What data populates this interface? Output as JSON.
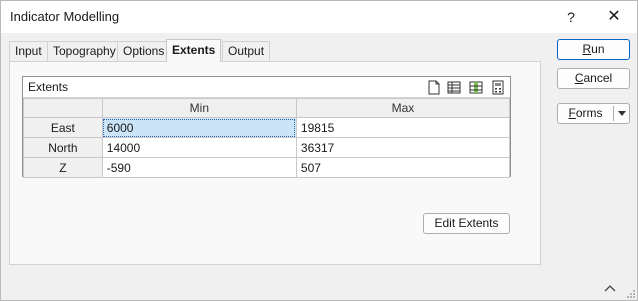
{
  "window": {
    "title": "Indicator Modelling",
    "help_label": "?",
    "close_label": "✕"
  },
  "tabs": [
    {
      "label": "Input",
      "active": false
    },
    {
      "label": "Topography",
      "active": false
    },
    {
      "label": "Options",
      "active": false
    },
    {
      "label": "Extents",
      "active": true
    },
    {
      "label": "Output",
      "active": false
    }
  ],
  "extents_grid": {
    "title": "Extents",
    "toolbar_icons": [
      "new-icon",
      "grid-list-icon",
      "select-column-icon",
      "calculator-icon"
    ],
    "columns": [
      "",
      "Min",
      "Max"
    ],
    "rows": [
      {
        "label": "East",
        "min": "6000",
        "max": "19815"
      },
      {
        "label": "North",
        "min": "14000",
        "max": "36317"
      },
      {
        "label": "Z",
        "min": "-590",
        "max": "507"
      }
    ]
  },
  "buttons": {
    "edit_extents": "Edit Extents",
    "run_prefix": "",
    "run_underline": "R",
    "run_rest": "un",
    "cancel_prefix": "",
    "cancel_underline": "C",
    "cancel_rest": "ancel",
    "forms_prefix": "",
    "forms_underline": "F",
    "forms_rest": "orms"
  }
}
